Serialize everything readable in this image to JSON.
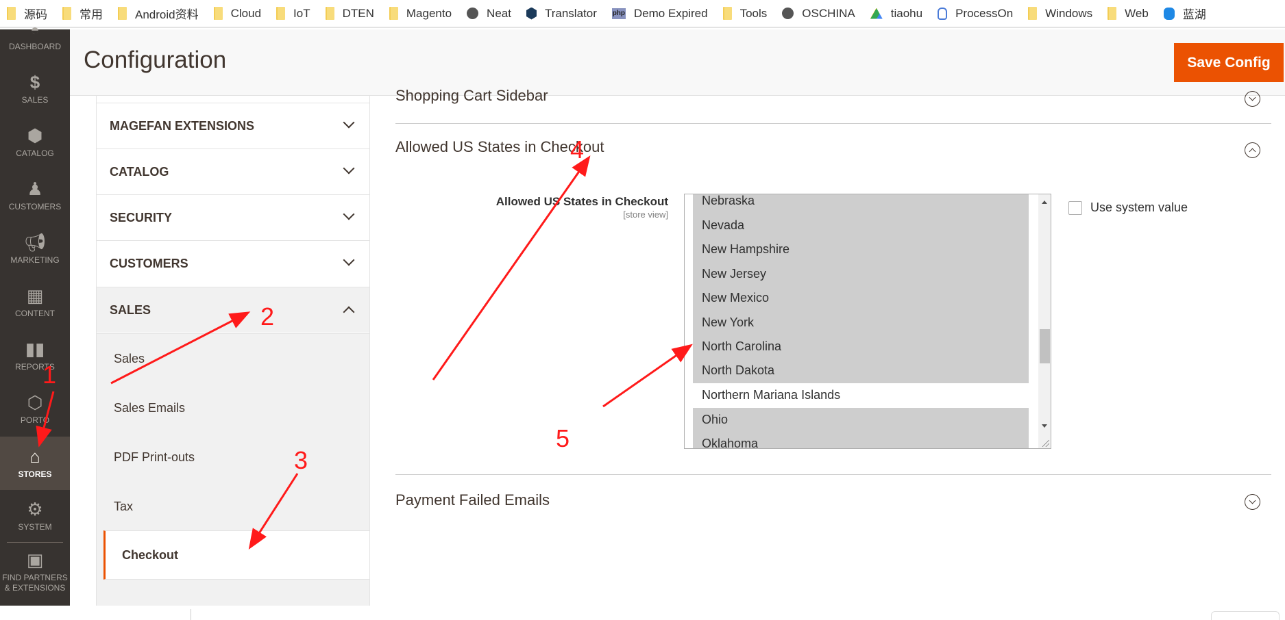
{
  "bookmarks": [
    {
      "label": "源码",
      "icon": "folder-icon"
    },
    {
      "label": "常用",
      "icon": "folder-icon"
    },
    {
      "label": "Android资料",
      "icon": "folder-icon"
    },
    {
      "label": "Cloud",
      "icon": "folder-icon"
    },
    {
      "label": "IoT",
      "icon": "folder-icon"
    },
    {
      "label": "DTEN",
      "icon": "folder-icon"
    },
    {
      "label": "Magento",
      "icon": "folder-icon"
    },
    {
      "label": "Neat",
      "icon": "globe-icon"
    },
    {
      "label": "Translator",
      "icon": "translator-icon"
    },
    {
      "label": "Demo Expired",
      "icon": "php-icon"
    },
    {
      "label": "Tools",
      "icon": "folder-icon"
    },
    {
      "label": "OSCHINA",
      "icon": "globe-icon"
    },
    {
      "label": "tiaohu",
      "icon": "google-drive-icon"
    },
    {
      "label": "ProcessOn",
      "icon": "hand-icon"
    },
    {
      "label": "Windows",
      "icon": "folder-icon"
    },
    {
      "label": "Web",
      "icon": "folder-icon"
    },
    {
      "label": "蓝湖",
      "icon": "lanhu-icon"
    }
  ],
  "admin_nav": {
    "items": [
      {
        "label": "DASHBOARD",
        "icon": "dashboard-icon"
      },
      {
        "label": "SALES",
        "icon": "dollar-icon"
      },
      {
        "label": "CATALOG",
        "icon": "box-icon"
      },
      {
        "label": "CUSTOMERS",
        "icon": "person-icon"
      },
      {
        "label": "MARKETING",
        "icon": "megaphone-icon"
      },
      {
        "label": "CONTENT",
        "icon": "layout-icon"
      },
      {
        "label": "REPORTS",
        "icon": "bar-chart-icon"
      },
      {
        "label": "PORTO",
        "icon": "hexagon-icon"
      },
      {
        "label": "STORES",
        "icon": "storefront-icon",
        "active": true
      },
      {
        "label": "SYSTEM",
        "icon": "gear-icon"
      },
      {
        "label": "FIND PARTNERS & EXTENSIONS",
        "icon": "lego-icon"
      }
    ]
  },
  "header": {
    "title": "Configuration",
    "save_label": "Save Config"
  },
  "config_tabs": {
    "groups": [
      {
        "label": "MAGEFAN EXTENSIONS",
        "expanded": false
      },
      {
        "label": "CATALOG",
        "expanded": false
      },
      {
        "label": "SECURITY",
        "expanded": false
      },
      {
        "label": "CUSTOMERS",
        "expanded": false
      },
      {
        "label": "SALES",
        "expanded": true
      }
    ],
    "sales_items": [
      {
        "label": "Sales"
      },
      {
        "label": "Sales Emails"
      },
      {
        "label": "PDF Print-outs"
      },
      {
        "label": "Tax"
      },
      {
        "label": "Checkout",
        "active": true
      }
    ]
  },
  "main": {
    "sections": [
      {
        "title": "Shopping Cart Sidebar",
        "expanded": false
      },
      {
        "title": "Allowed US States in Checkout",
        "expanded": true
      },
      {
        "title": "Payment Failed Emails",
        "expanded": false
      }
    ],
    "field": {
      "label": "Allowed US States in Checkout",
      "scope": "[store view]",
      "options": [
        {
          "label": "Nebraska",
          "selected": true
        },
        {
          "label": "Nevada",
          "selected": true
        },
        {
          "label": "New Hampshire",
          "selected": true
        },
        {
          "label": "New Jersey",
          "selected": true
        },
        {
          "label": "New Mexico",
          "selected": true
        },
        {
          "label": "New York",
          "selected": true
        },
        {
          "label": "North Carolina",
          "selected": true
        },
        {
          "label": "North Dakota",
          "selected": true
        },
        {
          "label": "Northern Mariana Islands",
          "selected": false
        },
        {
          "label": "Ohio",
          "selected": true
        },
        {
          "label": "Oklahoma",
          "selected": true
        }
      ],
      "use_system_value_label": "Use system value",
      "use_system_value_checked": false
    }
  },
  "annotations": [
    "1",
    "2",
    "3",
    "4",
    "5"
  ],
  "colors": {
    "accent": "#eb5202",
    "admin_nav_bg": "#373330",
    "admin_nav_active": "#514943",
    "selected_option_bg": "#cecece",
    "annotation": "#ff1a1a"
  }
}
